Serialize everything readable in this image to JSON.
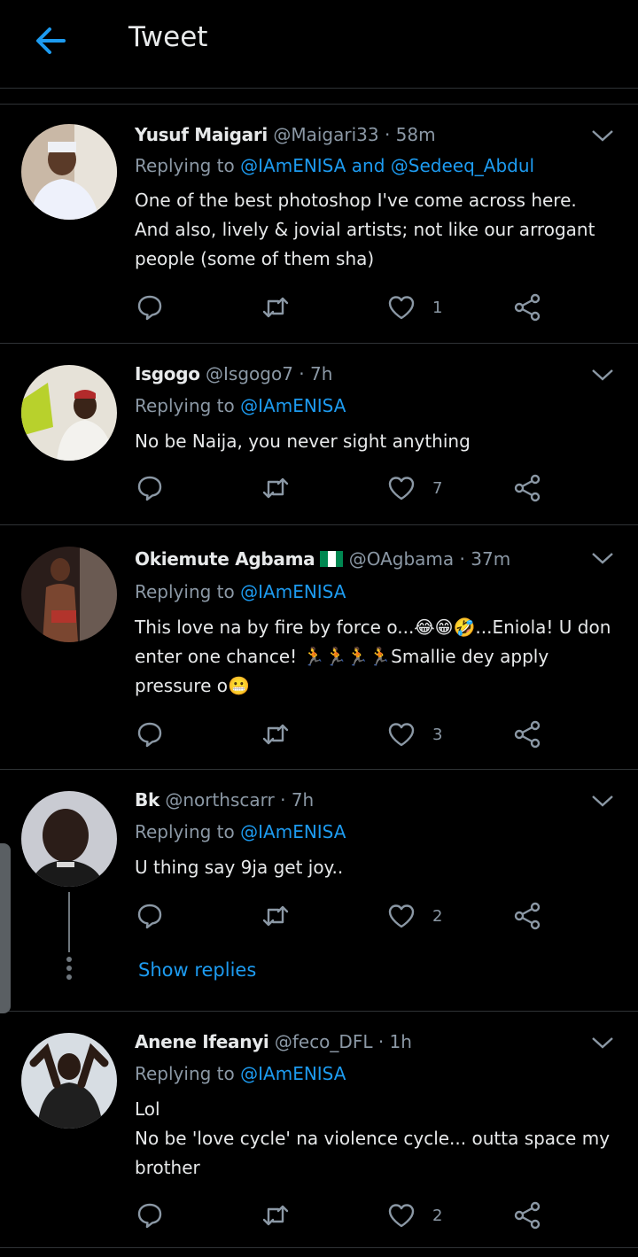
{
  "header": {
    "title": "Tweet"
  },
  "colors": {
    "accent": "#1d9bf0",
    "muted": "#8b98a5",
    "background": "#000000",
    "divider": "#2f3336"
  },
  "tweets": [
    {
      "name": "Yusuf Maigari",
      "handle": "@Maigari33",
      "time": "58m",
      "replying_prefix": "Replying to",
      "replying_to": "@IAmENISA and @Sedeeq_Abdul",
      "text": "One of the best photoshop I've come across here. And also, lively & jovial artists; not like our arrogant people (some of them sha)",
      "likes": "1"
    },
    {
      "name": "Isgogo",
      "handle": "@Isgogo7",
      "time": "7h",
      "replying_prefix": "Replying to",
      "replying_to": "@IAmENISA",
      "text": "No be Naija, you never sight anything",
      "likes": "7"
    },
    {
      "name": "Okiemute Agbama",
      "handle": "@OAgbama",
      "time": "37m",
      "replying_prefix": "Replying to",
      "replying_to": "@IAmENISA",
      "text": "This love na by fire by force o...😂😁🤣...Eniola! U don enter one chance! 🏃🏃🏃🏃Smallie dey apply pressure o😬",
      "likes": "3"
    },
    {
      "name": "Bk",
      "handle": "@northscarr",
      "time": "7h",
      "replying_prefix": "Replying to",
      "replying_to": "@IAmENISA",
      "text": "U thing say 9ja get joy..",
      "likes": "2"
    },
    {
      "name": "Anene Ifeanyi",
      "handle": "@feco_DFL",
      "time": "1h",
      "replying_prefix": "Replying to",
      "replying_to": "@IAmENISA",
      "text": "Lol\nNo be 'love cycle' na violence cycle... outta space my brother",
      "likes": "2"
    }
  ],
  "show_replies": "Show replies",
  "icons": [
    "back-arrow-icon",
    "chevron-down-icon",
    "reply-icon",
    "retweet-icon",
    "like-icon",
    "share-icon",
    "nigeria-flag-icon"
  ]
}
